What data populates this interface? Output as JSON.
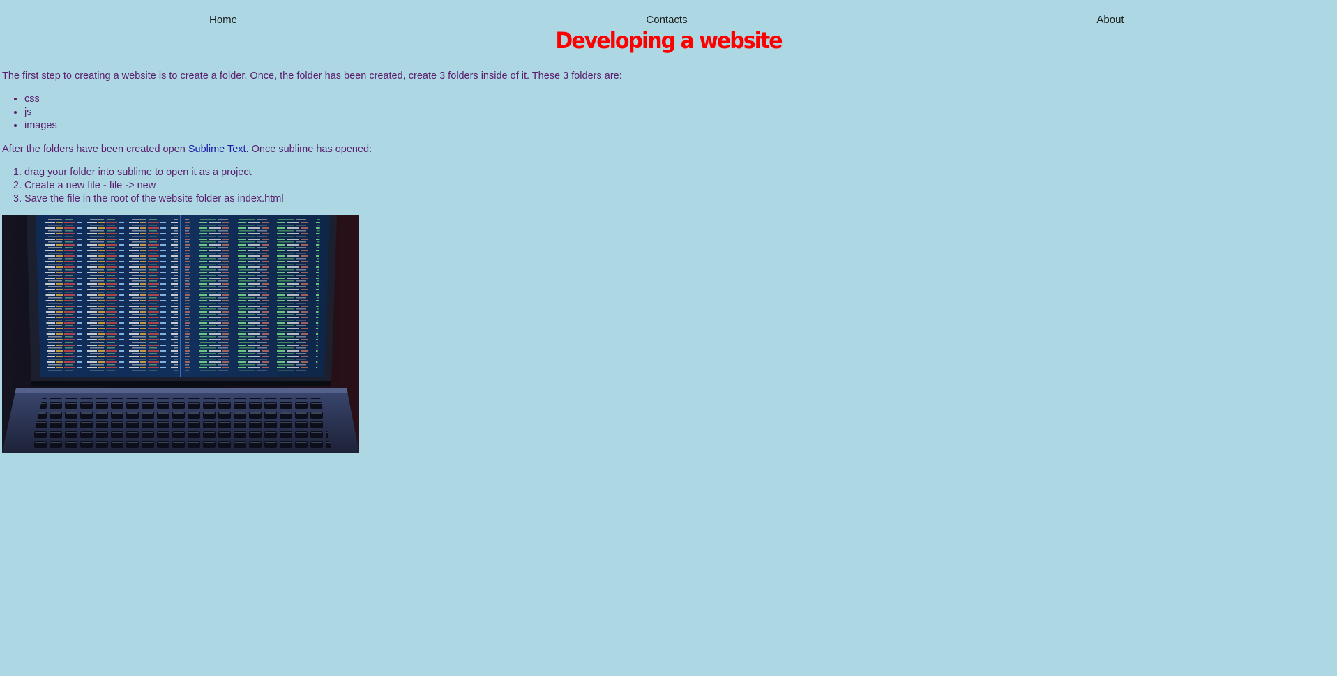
{
  "nav": {
    "home": "Home",
    "contacts": "Contacts",
    "about": "About"
  },
  "page": {
    "title": "Developing a website"
  },
  "intro": {
    "text": "The first step to creating a website is to create a folder. Once, the folder has been created, create 3 folders inside of it. These 3 folders are:"
  },
  "folders": [
    "css",
    "js",
    "images"
  ],
  "after": {
    "before_link": "After the folders have been created open ",
    "link_text": "Sublime Text",
    "after_link": ". Once sublime has opened:"
  },
  "steps": [
    "drag your folder into sublime to open it as a project",
    "Create a new file - file -> new",
    "Save the file in the root of the website folder as index.html"
  ],
  "colors": {
    "background": "#add8e3",
    "title": "#ff0000",
    "body_text": "#5a1e6e",
    "link": "#1a1aa8"
  },
  "image": {
    "subject": "laptop-with-code-on-screen"
  }
}
